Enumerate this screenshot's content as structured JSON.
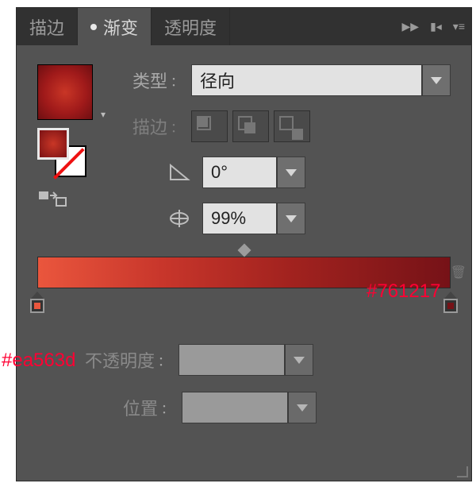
{
  "tabs": {
    "stroke": "描边",
    "gradient": "渐变",
    "transparency": "透明度"
  },
  "labels": {
    "type": "类型",
    "stroke": "描边",
    "opacity": "不透明度",
    "position": "位置",
    "colon": "："
  },
  "type_select": {
    "value": "径向"
  },
  "angle": {
    "value": "0°"
  },
  "aspect": {
    "value": "99%"
  },
  "opacity": {
    "value": ""
  },
  "position": {
    "value": ""
  },
  "gradient": {
    "stops": [
      {
        "offset": 0,
        "color": "#ea563d"
      },
      {
        "offset": 100,
        "color": "#761217"
      }
    ]
  },
  "annotations": {
    "left_stop": "#ea563d",
    "right_stop": "#761217"
  }
}
